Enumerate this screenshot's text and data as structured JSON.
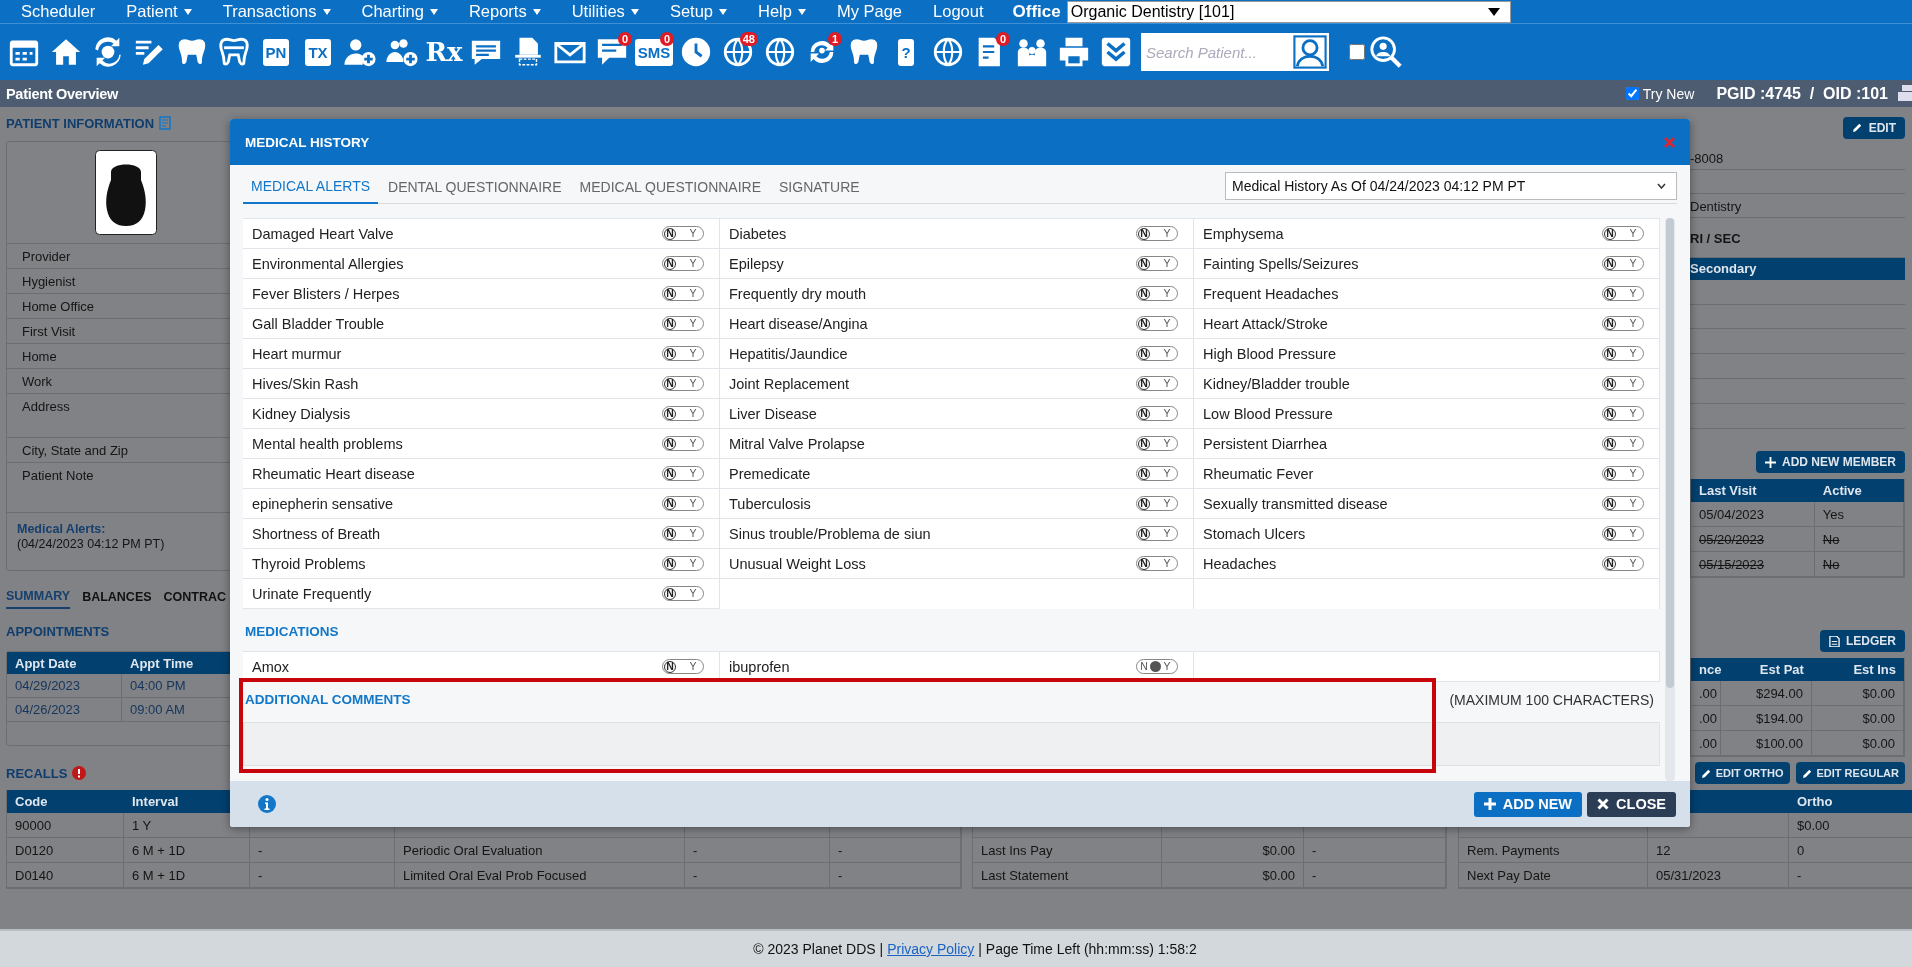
{
  "menu": {
    "items": [
      {
        "label": "Scheduler",
        "dropdown": false
      },
      {
        "label": "Patient",
        "dropdown": true
      },
      {
        "label": "Transactions",
        "dropdown": true
      },
      {
        "label": "Charting",
        "dropdown": true
      },
      {
        "label": "Reports",
        "dropdown": true
      },
      {
        "label": "Utilities",
        "dropdown": true
      },
      {
        "label": "Setup",
        "dropdown": true
      },
      {
        "label": "Help",
        "dropdown": true
      },
      {
        "label": "My Page",
        "dropdown": false
      },
      {
        "label": "Logout",
        "dropdown": false
      }
    ],
    "office_label": "Office",
    "office_select": "Organic Dentistry [101]"
  },
  "toolbar": {
    "labels": [
      "PN",
      "TX",
      "Rx",
      "SMS",
      "?"
    ],
    "badges": [
      "0",
      "0",
      "48",
      "1",
      "0"
    ],
    "search": {
      "placeholder": "Search Patient..."
    },
    "checkbox": {
      "checked": false
    }
  },
  "overview_bar": {
    "title": "Patient Overview",
    "try_new": {
      "label": "Try New",
      "checked": true
    },
    "ids": "PGID :4745  /  OID :101"
  },
  "patient_info": {
    "heading": "PATIENT INFORMATION",
    "fields": [
      "Provider",
      "Hygienist",
      "Home Office",
      "First Visit",
      "Home",
      "Work",
      "Address",
      "City, State and Zip",
      "Patient Note"
    ],
    "medical_alerts_label": "Medical Alerts:",
    "medical_alerts_value": "(04/24/2023 04:12 PM PT)"
  },
  "summary_tabs": [
    {
      "label": "SUMMARY",
      "selected": true
    },
    {
      "label": "BALANCES",
      "selected": false
    },
    {
      "label": "CONTRAC",
      "selected": false
    }
  ],
  "appointments": {
    "heading": "APPOINTMENTS",
    "columns": [
      "Appt Date",
      "Appt Time"
    ],
    "rows": [
      [
        "04/29/2023",
        "04:00 PM"
      ],
      [
        "04/26/2023",
        "09:00 AM"
      ]
    ]
  },
  "recalls": {
    "heading": "RECALLS",
    "alert": true,
    "columns": [
      "Code",
      "Interval",
      null,
      null,
      null,
      null
    ],
    "rows": [
      [
        "90000",
        "1 Y",
        null,
        null,
        null,
        null
      ],
      [
        "D0120",
        "6 M + 1D",
        "-",
        "Periodic Oral Evaluation",
        "-",
        "-"
      ],
      [
        "D0140",
        "6 M + 1D",
        "-",
        "Limited Oral Eval Prob Focused",
        "-",
        "-"
      ]
    ]
  },
  "payments": {
    "columns": [
      null,
      null,
      null
    ],
    "rows": [
      [
        null,
        null,
        null
      ],
      [
        "Last Ins Pay",
        "$0.00",
        "-"
      ],
      [
        "Last Statement",
        "$0.00",
        "-"
      ]
    ]
  },
  "ortho": {
    "buttons": [
      "EDIT ORTHO",
      "EDIT REGULAR"
    ],
    "columns": [
      null,
      null,
      "Ortho"
    ],
    "rows": [
      [
        null,
        null,
        "$0.00"
      ],
      [
        "Rem. Payments",
        "12",
        "0"
      ],
      [
        "Next Pay Date",
        "05/31/2023",
        "-"
      ]
    ]
  },
  "contact": {
    "edit_button": "EDIT",
    "rows": [
      {
        "text": "-8008",
        "emphasis": false
      },
      null,
      {
        "text": "Dentistry",
        "emphasis": false
      },
      {
        "text": "RI / SEC",
        "emphasis": true
      }
    ],
    "insurance_header": "Secondary"
  },
  "family": {
    "button": "ADD NEW MEMBER",
    "columns": [
      "Last Visit",
      "Active"
    ],
    "rows": [
      {
        "cells": [
          "05/04/2023",
          "Yes"
        ],
        "inactive": false
      },
      {
        "cells": [
          "05/20/2023",
          "No"
        ],
        "inactive": true
      },
      {
        "cells": [
          "05/15/2023",
          "No"
        ],
        "inactive": true
      }
    ]
  },
  "ledger": {
    "button": "LEDGER",
    "columns": [
      "nce",
      "Est Pat",
      "Est Ins"
    ],
    "rows": [
      [
        ".00",
        "$294.00",
        "$0.00"
      ],
      [
        ".00",
        "$194.00",
        "$0.00"
      ],
      [
        ".00",
        "$100.00",
        "$0.00"
      ]
    ]
  },
  "medical_history": {
    "title": "MEDICAL HISTORY",
    "tabs": [
      {
        "label": "MEDICAL ALERTS",
        "selected": true
      },
      {
        "label": "DENTAL QUESTIONNAIRE",
        "selected": false
      },
      {
        "label": "MEDICAL QUESTIONNAIRE",
        "selected": false
      },
      {
        "label": "SIGNATURE",
        "selected": false
      }
    ],
    "as_of": "Medical History As Of 04/24/2023 04:12 PM PT",
    "alerts": [
      {
        "name": "Damaged Heart Valve",
        "yes": false,
        "unanswered": false,
        "toggle": [
          "N",
          "Y"
        ]
      },
      {
        "name": "Diabetes",
        "yes": false,
        "unanswered": false,
        "toggle": [
          "N",
          "Y"
        ]
      },
      {
        "name": "Emphysema",
        "yes": false,
        "unanswered": false,
        "toggle": [
          "N",
          "Y"
        ]
      },
      {
        "name": "Environmental Allergies",
        "yes": false,
        "unanswered": false,
        "toggle": [
          "N",
          "Y"
        ]
      },
      {
        "name": "Epilepsy",
        "yes": false,
        "unanswered": false,
        "toggle": [
          "N",
          "Y"
        ]
      },
      {
        "name": "Fainting Spells/Seizures",
        "yes": false,
        "unanswered": false,
        "toggle": [
          "N",
          "Y"
        ]
      },
      {
        "name": "Fever Blisters / Herpes",
        "yes": false,
        "unanswered": false,
        "toggle": [
          "N",
          "Y"
        ]
      },
      {
        "name": "Frequently dry mouth",
        "yes": false,
        "unanswered": false,
        "toggle": [
          "N",
          "Y"
        ]
      },
      {
        "name": "Frequent Headaches",
        "yes": false,
        "unanswered": false,
        "toggle": [
          "N",
          "Y"
        ]
      },
      {
        "name": "Gall Bladder Trouble",
        "yes": false,
        "unanswered": false,
        "toggle": [
          "N",
          "Y"
        ]
      },
      {
        "name": "Heart disease/Angina",
        "yes": false,
        "unanswered": false,
        "toggle": [
          "N",
          "Y"
        ]
      },
      {
        "name": "Heart Attack/Stroke",
        "yes": false,
        "unanswered": false,
        "toggle": [
          "N",
          "Y"
        ]
      },
      {
        "name": "Heart murmur",
        "yes": false,
        "unanswered": false,
        "toggle": [
          "N",
          "Y"
        ]
      },
      {
        "name": "Hepatitis/Jaundice",
        "yes": false,
        "unanswered": false,
        "toggle": [
          "N",
          "Y"
        ]
      },
      {
        "name": "High Blood Pressure",
        "yes": false,
        "unanswered": false,
        "toggle": [
          "N",
          "Y"
        ]
      },
      {
        "name": "Hives/Skin Rash",
        "yes": false,
        "unanswered": false,
        "toggle": [
          "N",
          "Y"
        ]
      },
      {
        "name": "Joint Replacement",
        "yes": false,
        "unanswered": false,
        "toggle": [
          "N",
          "Y"
        ]
      },
      {
        "name": "Kidney/Bladder trouble",
        "yes": false,
        "unanswered": false,
        "toggle": [
          "N",
          "Y"
        ]
      },
      {
        "name": "Kidney Dialysis",
        "yes": false,
        "unanswered": false,
        "toggle": [
          "N",
          "Y"
        ]
      },
      {
        "name": "Liver Disease",
        "yes": false,
        "unanswered": false,
        "toggle": [
          "N",
          "Y"
        ]
      },
      {
        "name": "Low Blood Pressure",
        "yes": false,
        "unanswered": false,
        "toggle": [
          "N",
          "Y"
        ]
      },
      {
        "name": "Mental health problems",
        "yes": false,
        "unanswered": false,
        "toggle": [
          "N",
          "Y"
        ]
      },
      {
        "name": "Mitral Valve Prolapse",
        "yes": false,
        "unanswered": false,
        "toggle": [
          "N",
          "Y"
        ]
      },
      {
        "name": "Persistent Diarrhea",
        "yes": false,
        "unanswered": false,
        "toggle": [
          "N",
          "Y"
        ]
      },
      {
        "name": "Rheumatic Heart disease",
        "yes": false,
        "unanswered": false,
        "toggle": [
          "N",
          "Y"
        ]
      },
      {
        "name": "Premedicate",
        "yes": false,
        "unanswered": false,
        "toggle": [
          "N",
          "Y"
        ]
      },
      {
        "name": "Rheumatic Fever",
        "yes": false,
        "unanswered": false,
        "toggle": [
          "N",
          "Y"
        ]
      },
      {
        "name": "epinepherin sensative",
        "yes": false,
        "unanswered": false,
        "toggle": [
          "N",
          "Y"
        ]
      },
      {
        "name": "Tuberculosis",
        "yes": false,
        "unanswered": false,
        "toggle": [
          "N",
          "Y"
        ]
      },
      {
        "name": "Sexually transmitted disease",
        "yes": false,
        "unanswered": false,
        "toggle": [
          "N",
          "Y"
        ]
      },
      {
        "name": "Shortness of Breath",
        "yes": false,
        "unanswered": false,
        "toggle": [
          "N",
          "Y"
        ]
      },
      {
        "name": "Sinus trouble/Problema de siun",
        "yes": false,
        "unanswered": false,
        "toggle": [
          "N",
          "Y"
        ]
      },
      {
        "name": "Stomach Ulcers",
        "yes": false,
        "unanswered": false,
        "toggle": [
          "N",
          "Y"
        ]
      },
      {
        "name": "Thyroid Problems",
        "yes": false,
        "unanswered": false,
        "toggle": [
          "N",
          "Y"
        ]
      },
      {
        "name": "Unusual Weight Loss",
        "yes": false,
        "unanswered": false,
        "toggle": [
          "N",
          "Y"
        ]
      },
      {
        "name": "Headaches",
        "yes": false,
        "unanswered": false,
        "toggle": [
          "N",
          "Y"
        ]
      },
      {
        "name": "Urinate Frequently",
        "yes": false,
        "unanswered": false,
        "toggle": [
          "N",
          "Y"
        ]
      }
    ],
    "medications_heading": "MEDICATIONS",
    "medications": [
      {
        "name": "Amox",
        "yes": false,
        "unanswered": false,
        "toggle": [
          "N",
          "Y"
        ]
      },
      {
        "name": "ibuprofen",
        "yes": false,
        "unanswered": true,
        "toggle": [
          "N",
          "Y"
        ]
      }
    ],
    "comments": {
      "heading": "ADDITIONAL COMMENTS",
      "limit": "(MAXIMUM 100 CHARACTERS)",
      "highlighted": true
    },
    "buttons": [
      {
        "label": "ADD NEW",
        "kind": "add"
      },
      {
        "label": "CLOSE",
        "kind": "close"
      }
    ]
  },
  "footer": {
    "copyright": "© 2023 Planet DDS |",
    "link": "Privacy Policy",
    "time_left": "| Page Time Left (hh:mm:ss) 1:58:2"
  }
}
